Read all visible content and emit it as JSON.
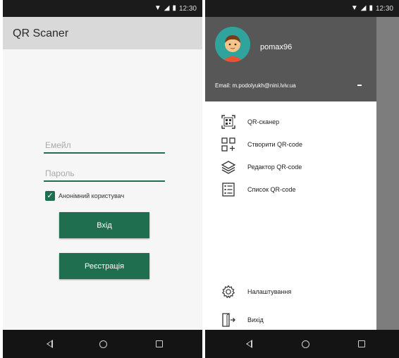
{
  "status_bar": {
    "time": "12:30"
  },
  "left_screen": {
    "app_title": "QR Scaner",
    "email_placeholder": "Емейл",
    "password_placeholder": "Пароль",
    "anonymous_label": "Анонімний користувач",
    "anonymous_checked": true,
    "login_label": "Вхід",
    "register_label": "Реєстрація"
  },
  "right_screen": {
    "username": "pomax96",
    "email": "Email: m.podolyukh@nini.lviv.ua",
    "menu": [
      {
        "label": "QR-сканер",
        "icon": "qr-scan-icon"
      },
      {
        "label": "Створити QR-code",
        "icon": "create-qr-icon"
      },
      {
        "label": "Редактор QR-code",
        "icon": "layers-icon"
      },
      {
        "label": "Список QR-code",
        "icon": "list-icon"
      }
    ],
    "settings_label": "Налаштування",
    "exit_label": "Вихід"
  },
  "colors": {
    "accent": "#1f6e4f",
    "appbar": "#d9d9d9",
    "drawer_header": "#575757",
    "status_bar": "#1b1b1b",
    "nav_bar": "#141414",
    "avatar_bg": "#2fa39c"
  }
}
